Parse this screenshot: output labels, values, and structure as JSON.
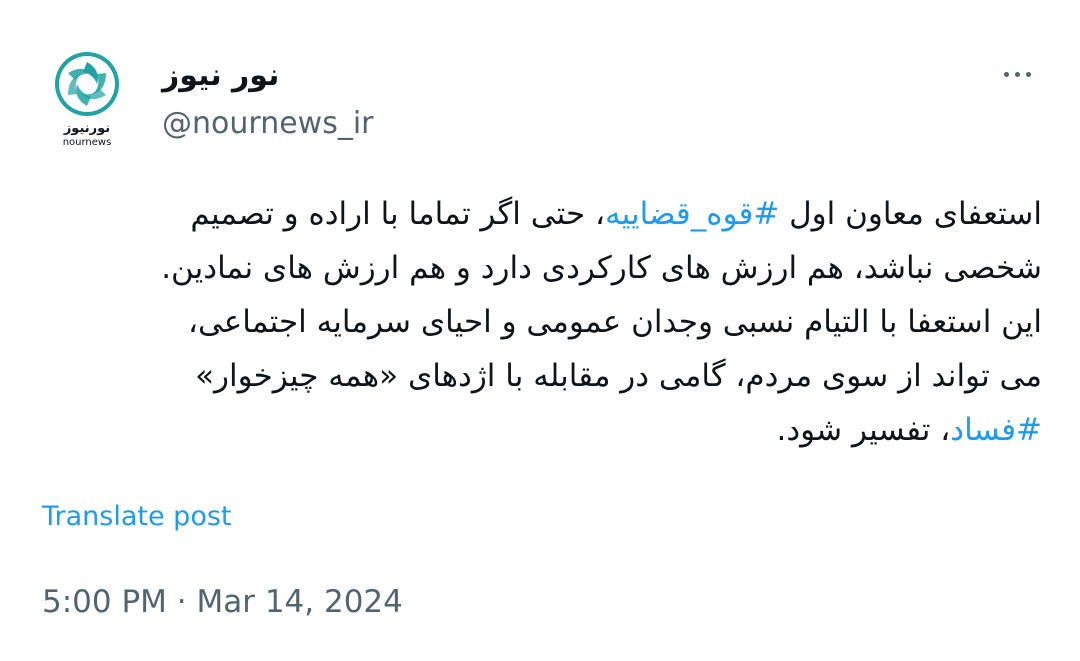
{
  "author": {
    "display_name": "نور نیوز",
    "handle": "@nournews_ir",
    "avatar_logo_text": "نورنیوز",
    "avatar_logo_sub": "nournews"
  },
  "tweet": {
    "lines": [
      {
        "pre": "استعفای معاون اول ",
        "tag": "#قوه_قضاییه",
        "post": "، حتی اگر تماما با اراده و تصمیم"
      },
      {
        "pre": "شخصی نباشد، هم ارزش های کارکردی دارد و هم ارزش های نمادین.",
        "tag": "",
        "post": ""
      },
      {
        "pre": "این استعفا با التیام نسبی وجدان عمومی و  احیای سرمایه اجتماعی،",
        "tag": "",
        "post": ""
      },
      {
        "pre": "می تواند از سوی مردم، گامی در مقابله با اژدهای «همه چیزخوار»",
        "tag": "",
        "post": ""
      },
      {
        "pre": "",
        "tag": "#فساد",
        "post": "، تفسیر شود."
      }
    ],
    "translate_label": "Translate post",
    "timestamp": "5:00 PM · Mar 14, 2024"
  },
  "colors": {
    "link": "#1d9bf0",
    "secondary": "#536471",
    "text": "#0f1419",
    "logo_teal": "#1fa3a3"
  },
  "icons": {
    "more": "more-dots-icon",
    "avatar": "nournews-logo-icon"
  }
}
